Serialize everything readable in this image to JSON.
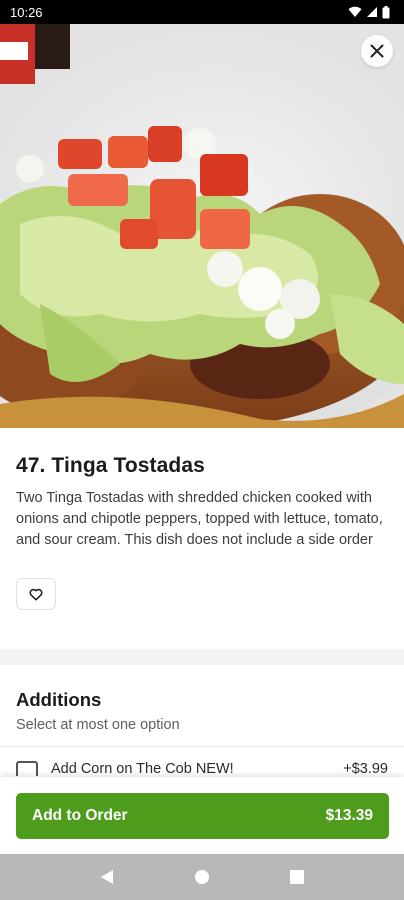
{
  "status_bar": {
    "time": "10:26",
    "icons": [
      "wifi-icon",
      "signal-icon",
      "battery-icon"
    ]
  },
  "hero": {
    "image_description_icon": "food-photo",
    "close_icon": "close-icon"
  },
  "item": {
    "title": "47. Tinga Tostadas",
    "description": "Two Tinga Tostadas with shredded chicken cooked with onions and chipotle peppers, topped with lettuce, tomato, and sour cream. This dish does not include a side order",
    "favorite_icon": "heart-icon"
  },
  "additions": {
    "title": "Additions",
    "subtitle": "Select at most one option",
    "options": [
      {
        "label": "Add Corn on The Cob NEW!",
        "price": "+$3.99",
        "checked": false
      }
    ]
  },
  "order": {
    "button_label": "Add to Order",
    "price": "$13.39"
  },
  "colors": {
    "accent": "#4e9c1b",
    "status_bar": "#000000",
    "nav_bar": "#b8b8b8"
  },
  "nav": {
    "icons": [
      "back-icon",
      "home-icon",
      "recents-icon"
    ]
  }
}
